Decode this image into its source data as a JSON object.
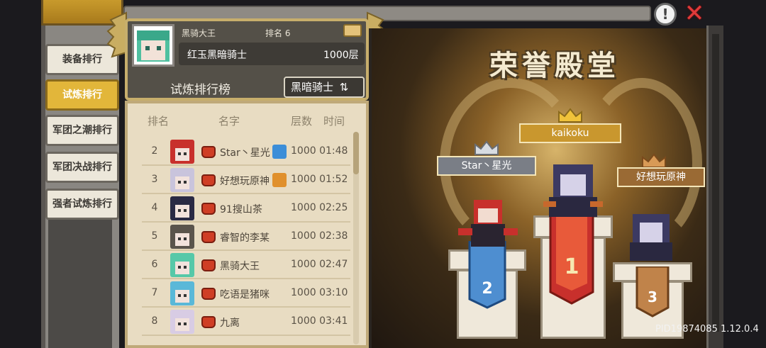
{
  "sidebar": {
    "tabs": [
      {
        "label": "装备排行",
        "active": false
      },
      {
        "label": "试炼排行",
        "active": true
      },
      {
        "label": "军团之潮排行",
        "active": false
      },
      {
        "label": "军团决战排行",
        "active": false
      },
      {
        "label": "强者试炼排行",
        "active": false
      }
    ]
  },
  "player_card": {
    "name": "黑骑大王",
    "rank": "排名 6",
    "title": "红玉黑暗骑士",
    "floor": "1000层",
    "board_title": "试炼排行榜",
    "class_switch": "黑暗骑士",
    "class_switch_icon": "swap-arrows-icon"
  },
  "leaderboard": {
    "headers": {
      "rank": "排名",
      "name": "名字",
      "floor": "层数",
      "time": "时间"
    },
    "rows": [
      {
        "rank": "2",
        "name": "Star丶星光",
        "floor": "1000",
        "time": "01:48",
        "avatar_color": "#c8302c",
        "badge_color": "#3c8ed8"
      },
      {
        "rank": "3",
        "name": "好想玩原神",
        "floor": "1000",
        "time": "01:52",
        "avatar_color": "#c9c4dc",
        "badge_color": "#e0902c"
      },
      {
        "rank": "4",
        "name": "91搜山茶",
        "floor": "1000",
        "time": "02:25",
        "avatar_color": "#2a2a44",
        "badge_color": ""
      },
      {
        "rank": "5",
        "name": "睿智的李某",
        "floor": "1000",
        "time": "02:38",
        "avatar_color": "#5a544c",
        "badge_color": ""
      },
      {
        "rank": "6",
        "name": "黑骑大王",
        "floor": "1000",
        "time": "02:47",
        "avatar_color": "#56c8a8",
        "badge_color": ""
      },
      {
        "rank": "7",
        "name": "吃语是猪咪",
        "floor": "1000",
        "time": "03:10",
        "avatar_color": "#5ab8d8",
        "badge_color": ""
      },
      {
        "rank": "8",
        "name": "九离",
        "floor": "1000",
        "time": "03:41",
        "avatar_color": "#d8cce4",
        "badge_color": ""
      }
    ]
  },
  "hall_of_fame": {
    "title": "荣誉殿堂",
    "podium": [
      {
        "place": "1",
        "name": "kaikoku"
      },
      {
        "place": "2",
        "name": "Star丶星光"
      },
      {
        "place": "3",
        "name": "好想玩原神"
      }
    ]
  },
  "topbar": {
    "info_icon": "info-icon",
    "close_icon": "close-icon",
    "info_label": "!",
    "close_label": "✕"
  },
  "footer": {
    "pid": "PID19874085 1.12.0.4"
  },
  "colors": {
    "active_tab": "#e2b63a",
    "gold": "#c7ae6c",
    "red_banner": "#c8302c",
    "blue_banner": "#4e8ed0"
  }
}
